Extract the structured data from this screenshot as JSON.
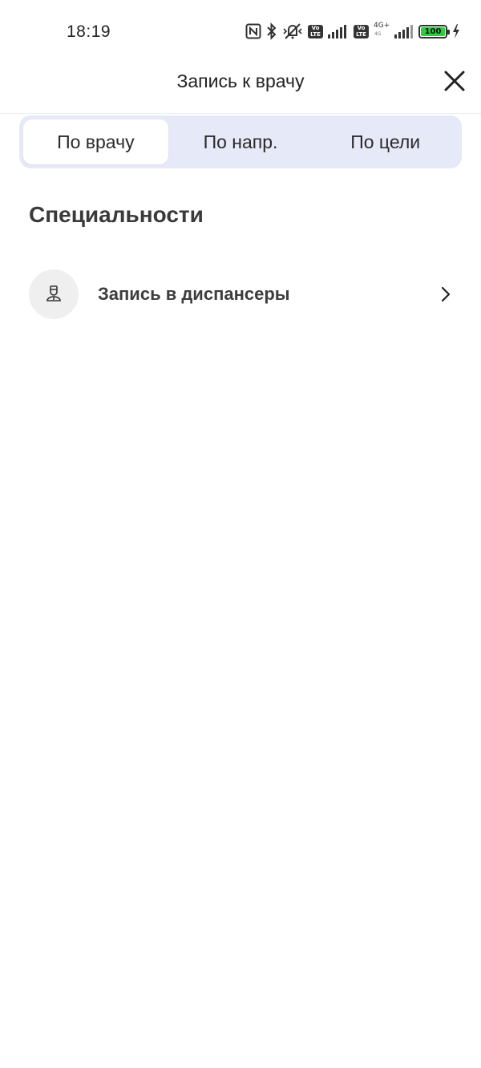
{
  "status_bar": {
    "time": "18:19",
    "icons": [
      "nfc-icon",
      "bluetooth-icon",
      "vibrate-off-icon",
      "volte-icon",
      "signal-icon",
      "volte-icon",
      "4g-signal-icon",
      "battery-icon",
      "charging-icon"
    ],
    "volte_top": "Vo",
    "volte_bottom": "LTE",
    "network_type": "4G+",
    "network_sub": "4G",
    "battery_level": "100",
    "battery_color": "#2ecc40"
  },
  "header": {
    "title": "Запись к врачу",
    "close_icon": "close-icon"
  },
  "tabs": [
    {
      "label": "По врачу",
      "active": true
    },
    {
      "label": "По напр.",
      "active": false
    },
    {
      "label": "По цели",
      "active": false
    }
  ],
  "section": {
    "title": "Специальности",
    "items": [
      {
        "label": "Запись в диспансеры",
        "icon": "doctor-icon",
        "chevron": "chevron-right-icon"
      }
    ]
  },
  "colors": {
    "tabs_background": "#e6e9f8",
    "active_tab": "#ffffff",
    "icon_circle": "#efefef"
  }
}
